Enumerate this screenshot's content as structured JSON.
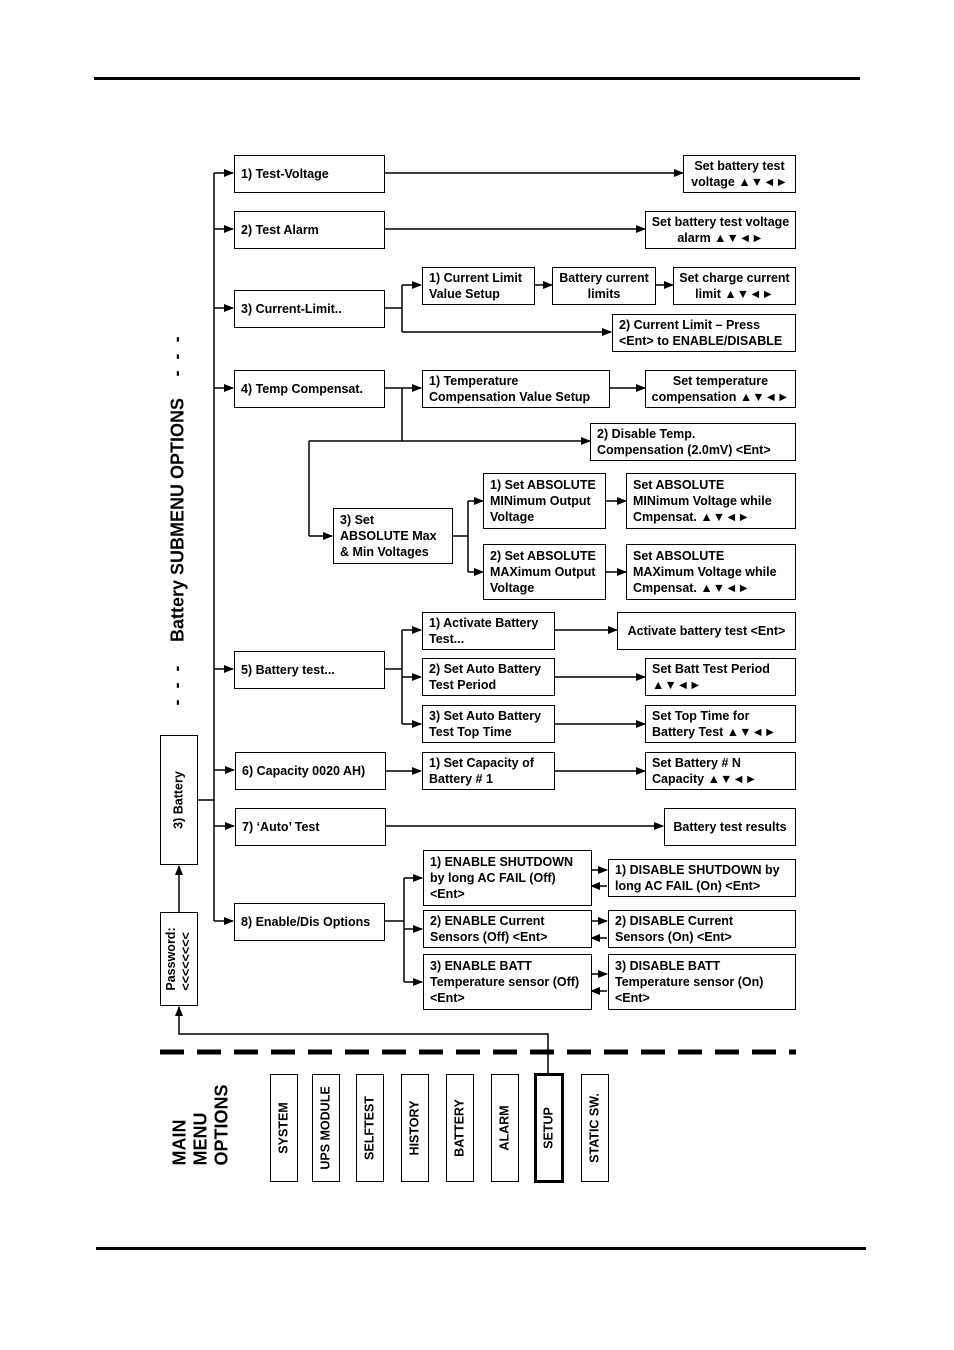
{
  "side_label": "Battery SUBMENU OPTIONS",
  "ellipsis": "- - -",
  "battery_node": "3) Battery",
  "password_node": "Password:\n<<<<<<<<",
  "submenu": [
    {
      "label": "1) Test-Voltage"
    },
    {
      "label": "2) Test Alarm"
    },
    {
      "label": "3) Current-Limit.."
    },
    {
      "label": "4) Temp Compensat."
    },
    {
      "label": "5) Battery test..."
    },
    {
      "label": "6) Capacity 0020 AH)"
    },
    {
      "label": "7) ‘Auto’ Test"
    },
    {
      "label": "8) Enable/Dis Options"
    }
  ],
  "nodes": {
    "test_voltage_set": "Set battery test\nvoltage ▲▼◄►",
    "test_alarm_set": "Set battery test voltage\nalarm ▲▼◄►",
    "cl_value_setup": "1) Current Limit\nValue Setup",
    "cl_battery_limits": "Battery current\nlimits",
    "cl_set_charge": "Set charge current\nlimit ▲▼◄►",
    "cl_enable_disable": "2) Current Limit – Press\n<Ent> to ENABLE/DISABLE",
    "tc_value_setup": "1) Temperature\nCompensation Value Setup",
    "tc_set": "Set temperature\ncompensation ▲▼◄►",
    "tc_disable": "2) Disable Temp.\nCompensation (2.0mV) <Ent>",
    "tc_abs": "3) Set\nABSOLUTE Max\n& Min Voltages",
    "tc_abs_min": "1) Set ABSOLUTE\nMINimum Output\nVoltage",
    "tc_abs_min_set": "Set ABSOLUTE\nMINimum  Voltage while\nCmpensat. ▲▼◄►",
    "tc_abs_max": "2) Set ABSOLUTE\nMAXimum Output\nVoltage",
    "tc_abs_max_set": "Set ABSOLUTE\nMAXimum  Voltage while\nCmpensat. ▲▼◄►",
    "bt_activate": "1) Activate Battery\nTest...",
    "bt_activate_set": "Activate battery test <Ent>",
    "bt_period": "2) Set Auto Battery\nTest Period",
    "bt_period_set": "Set Batt Test Period\n▲▼◄►",
    "bt_top": "3) Set Auto Battery\nTest Top Time",
    "bt_top_set": "Set Top Time for\nBattery Test ▲▼◄►",
    "cap_set": "1) Set Capacity of\nBattery # 1",
    "cap_set_n": "Set Battery # N\nCapacity ▲▼◄►",
    "auto_results": "Battery test results",
    "en_shutdown": "1) ENABLE SHUTDOWN\nby long AC FAIL (Off)\n<Ent>",
    "dis_shutdown": "1) DISABLE SHUTDOWN by\nlong AC FAIL (On) <Ent>",
    "en_current": "2) ENABLE Current\nSensors (Off) <Ent>",
    "dis_current": "2) DISABLE Current\nSensors (On) <Ent>",
    "en_batt_temp": "3) ENABLE BATT\nTemperature sensor (Off)\n<Ent>",
    "dis_batt_temp": "3) DISABLE BATT\nTemperature sensor (On)\n<Ent>"
  },
  "main_menu": {
    "label": "MAIN\nMENU\nOPTIONS",
    "items": [
      "SYSTEM",
      "UPS MODULE",
      "SELFTEST",
      "HISTORY",
      "BATTERY",
      "ALARM",
      "SETUP",
      "STATIC SW."
    ],
    "selected": "SETUP"
  }
}
